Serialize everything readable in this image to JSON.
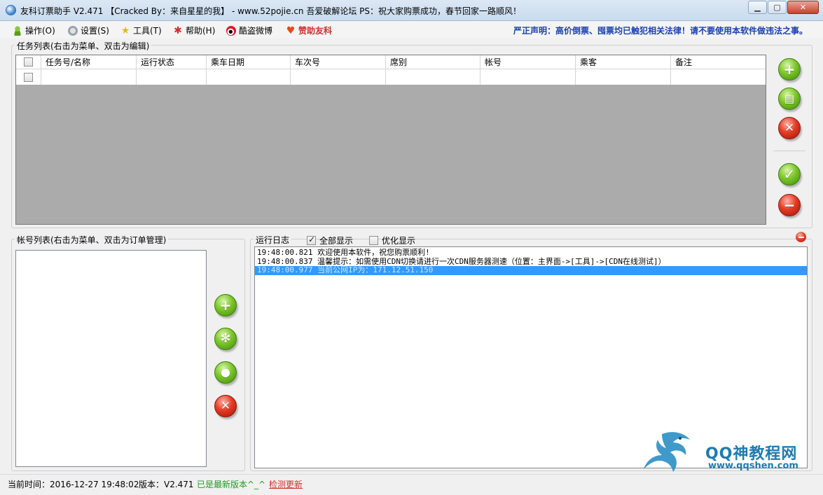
{
  "window": {
    "title": "友科订票助手 V2.471 【Cracked By：来自星星的我】 - www.52pojie.cn 吾爱破解论坛   PS：祝大家购票成功，春节回家一路顺风！",
    "minimize_icon": "minimize-icon",
    "maximize_icon": "maximize-icon",
    "close_icon": "close-icon"
  },
  "menu": {
    "items": [
      {
        "label": "操作(O)",
        "icon": "user-icon"
      },
      {
        "label": "设置(S)",
        "icon": "gear-icon"
      },
      {
        "label": "工具(T)",
        "icon": "star-icon"
      },
      {
        "label": "帮助(H)",
        "icon": "help-icon"
      },
      {
        "label": "酷盗微博",
        "icon": "weibo-icon"
      },
      {
        "label": "赞助友科",
        "icon": "heart-icon"
      }
    ],
    "notice": "严正声明：高价倒票、囤票均已触犯相关法律！请不要使用本软件做违法之事。"
  },
  "task_list": {
    "label": "任务列表(右击为菜单、双击为编辑)",
    "columns": [
      "任务号/名称",
      "运行状态",
      "乘车日期",
      "车次号",
      "席别",
      "帐号",
      "乘客",
      "备注"
    ],
    "row": [
      "",
      "",
      "",
      "",
      "",
      "",
      "",
      ""
    ]
  },
  "account_list": {
    "label": "帐号列表(右击为菜单、双击为订单管理)"
  },
  "log": {
    "label": "运行日志",
    "show_all": {
      "label": "全部显示",
      "checked": true
    },
    "optimize": {
      "label": "优化显示",
      "checked": false
    },
    "lines": [
      "19:48:00.821  欢迎使用本软件，祝您购票顺利!",
      "19:48:00.837  温馨提示：如需使用CDN切换请进行一次CDN服务器测速（位置：主界面->[工具]->[CDN在线测试]）",
      "19:48:00.977  当前公网IP为：171.12.51.150"
    ]
  },
  "watermark": {
    "title": "QQ神教程网",
    "url": "www.qqshen.com"
  },
  "status": {
    "time": "当前时间：2016-12-27 19:48:02",
    "version": "版本：V2.471",
    "latest": "已是最新版本^_^",
    "check_update": "检测更新"
  },
  "colors": {
    "notice": "#1a3fb0",
    "selected_log": "#3399ff",
    "status_green": "#1f9c1f",
    "link_red": "#d12f2f"
  }
}
